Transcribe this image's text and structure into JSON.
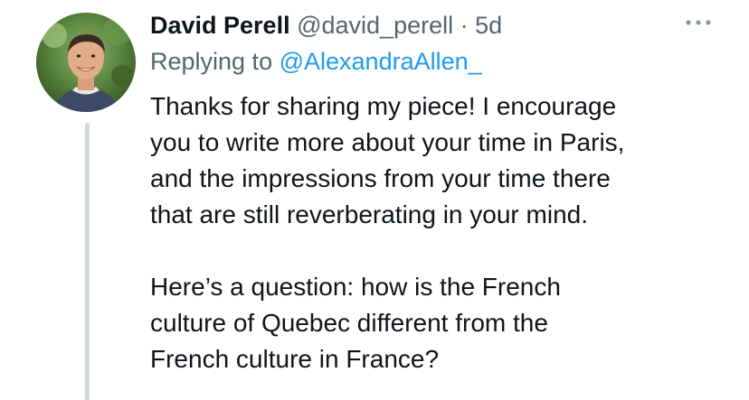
{
  "tweet": {
    "author": {
      "display_name": "David Perell",
      "handle": "@david_perell"
    },
    "separator": "·",
    "timestamp": "5d",
    "reply": {
      "prefix": "Replying to",
      "mention": "@AlexandraAllen_"
    },
    "text": "Thanks for sharing my piece! I encourage\nyou to write more about your time in Paris,\nand the impressions from your time there\nthat are still reverberating in your mind.\n\nHere’s a question: how is the French\nculture of Quebec different from the\nFrench culture in France?",
    "more_icon": "more-horizontal-icon"
  },
  "colors": {
    "primary_text": "#0f1419",
    "secondary_text": "#536471",
    "link": "#1d9bf0",
    "thread_line": "#cfd9de"
  }
}
